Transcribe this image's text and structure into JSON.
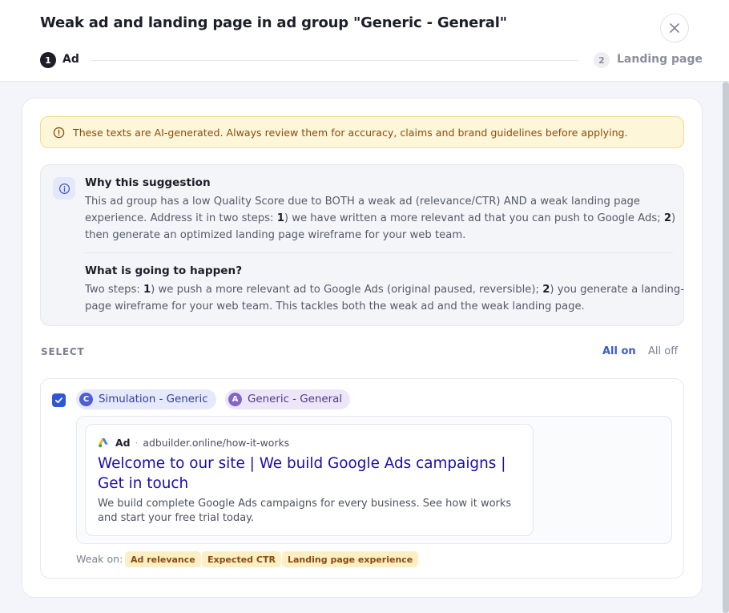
{
  "modal": {
    "title": "Weak ad and landing page in ad group \"Generic - General\""
  },
  "stepper": {
    "steps": [
      {
        "number": "1",
        "label": "Ad",
        "active": true
      },
      {
        "number": "2",
        "label": "Landing page",
        "active": false
      }
    ]
  },
  "ai_banner": {
    "text": "These texts are AI-generated. Always review them for accuracy, claims and brand guidelines before applying."
  },
  "info": {
    "why_title": "Why this suggestion",
    "why_line1": "This ad group has a low Quality Score due to BOTH a weak ad (relevance/CTR) AND a weak landing page",
    "why_line2_a": "experience. Address it in two steps: ",
    "why_line2_n1": "1",
    "why_line2_b": ") we have written a more relevant ad that you can push to Google Ads; ",
    "why_line2_n2": "2",
    "why_line2_c": ")",
    "why_line3": "then generate an optimized landing page wireframe for your web team.",
    "what_title": "What is going to happen?",
    "what_line1_a": "Two steps: ",
    "what_line1_n1": "1",
    "what_line1_b": ") we push a more relevant ad to Google Ads (original paused, reversible); ",
    "what_line1_n2": "2",
    "what_line1_c": ") you generate a landing-",
    "what_line2": "page wireframe for your web team. This tackles both the weak ad and the weak landing page."
  },
  "select": {
    "label": "SELECT",
    "all_on": "All on",
    "all_off": "All off"
  },
  "item": {
    "checked": true,
    "campaign_chip": {
      "initial": "C",
      "label": "Simulation - Generic"
    },
    "adgroup_chip": {
      "initial": "A",
      "label": "Generic - General"
    },
    "ad": {
      "badge": "Ad",
      "separator": "·",
      "display_url": "adbuilder.online/how-it-works",
      "headline": "Welcome to our site | We build Google Ads campaigns | Get in touch",
      "description": "We build complete Google Ads campaigns for every business. See how it works and start your free trial today."
    },
    "weak_on_label": "Weak on:",
    "weak_on": [
      "Ad relevance",
      "Expected CTR",
      "Landing page experience"
    ]
  },
  "colors": {
    "primary": "#2f56d8",
    "link_blue": "#1a0dab",
    "warning_bg": "#fdf6d8",
    "warning_text": "#8a4b10",
    "badge_bg": "#fdefc5"
  }
}
